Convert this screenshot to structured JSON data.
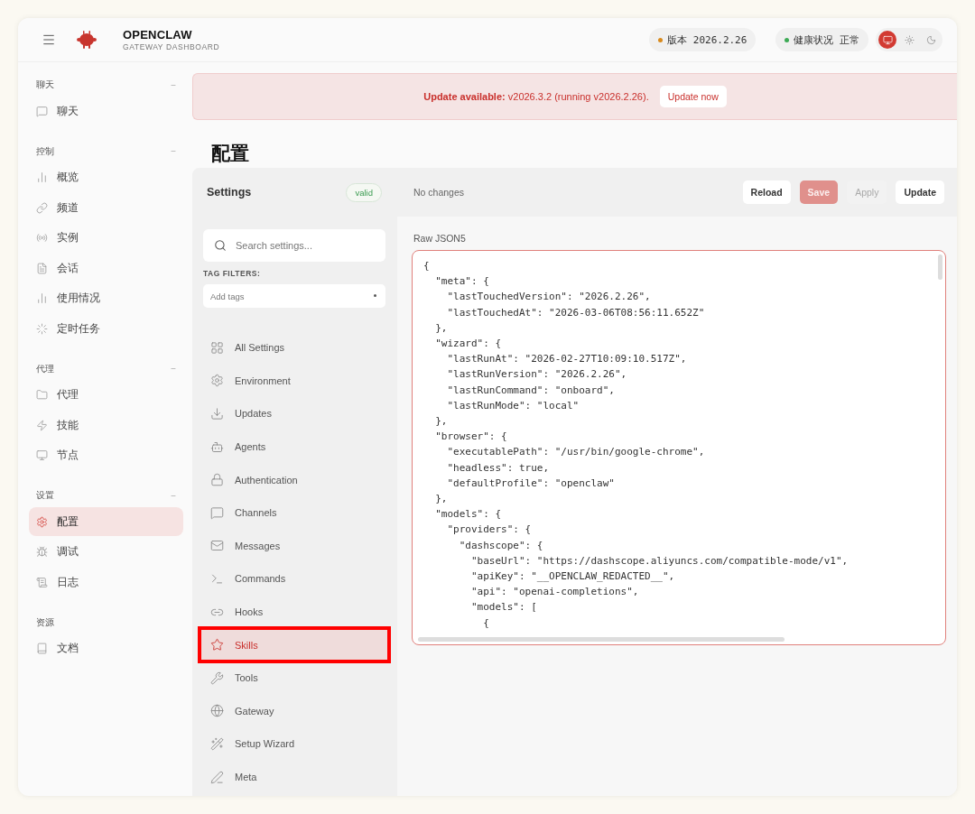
{
  "header": {
    "brand": "OPENCLAW",
    "subtitle": "GATEWAY DASHBOARD",
    "pills": [
      {
        "label": "版本",
        "value": "2026.2.26",
        "color": "#d98a1c"
      },
      {
        "label": "健康状况",
        "value": "正常",
        "color": "#3daa55"
      }
    ],
    "theme_modes": [
      {
        "selected": true
      },
      {
        "selected": false
      },
      {
        "selected": false
      }
    ]
  },
  "sidebar": {
    "groups": [
      {
        "title": "聊天",
        "toggle": "−",
        "items": [
          {
            "label": "聊天",
            "selected": false
          }
        ]
      },
      {
        "title": "控制",
        "toggle": "−",
        "items": [
          {
            "label": "概览",
            "selected": false
          },
          {
            "label": "频道",
            "selected": false
          },
          {
            "label": "实例",
            "selected": false
          },
          {
            "label": "会话",
            "selected": false
          },
          {
            "label": "使用情况",
            "selected": false
          },
          {
            "label": "定时任务",
            "selected": false
          }
        ]
      },
      {
        "title": "代理",
        "toggle": "−",
        "items": [
          {
            "label": "代理",
            "selected": false
          },
          {
            "label": "技能",
            "selected": false
          },
          {
            "label": "节点",
            "selected": false
          }
        ]
      },
      {
        "title": "设置",
        "toggle": "−",
        "items": [
          {
            "label": "配置",
            "selected": true
          },
          {
            "label": "调试",
            "selected": false
          },
          {
            "label": "日志",
            "selected": false
          }
        ]
      },
      {
        "title": "资源",
        "items": [
          {
            "label": "文档",
            "selected": false
          }
        ]
      }
    ]
  },
  "banner": {
    "lead": "**Update available:** v2026.3.2 (running v2026.2.26).",
    "button": "Update now"
  },
  "page": {
    "title": "配置"
  },
  "settings": {
    "title": "Settings",
    "badge": "valid",
    "search": {
      "placeholder": "Search settings..."
    },
    "tag_filters_label": "TAG FILTERS:",
    "tags": {
      "placeholder": "Add tags"
    },
    "nav": [
      {
        "label": "All Settings",
        "selected": false,
        "annotated": false
      },
      {
        "label": "Environment",
        "selected": false,
        "annotated": false
      },
      {
        "label": "Updates",
        "selected": false,
        "annotated": false
      },
      {
        "label": "Agents",
        "selected": false,
        "annotated": false
      },
      {
        "label": "Authentication",
        "selected": false,
        "annotated": false
      },
      {
        "label": "Channels",
        "selected": false,
        "annotated": false
      },
      {
        "label": "Messages",
        "selected": false,
        "annotated": false
      },
      {
        "label": "Commands",
        "selected": false,
        "annotated": false
      },
      {
        "label": "Hooks",
        "selected": false,
        "annotated": false
      },
      {
        "label": "Skills",
        "selected": true,
        "annotated": true
      },
      {
        "label": "Tools",
        "selected": false,
        "annotated": false
      },
      {
        "label": "Gateway",
        "selected": false,
        "annotated": false
      },
      {
        "label": "Setup Wizard",
        "selected": false,
        "annotated": false
      },
      {
        "label": "Meta",
        "selected": false,
        "annotated": false
      }
    ]
  },
  "toolbar": {
    "status": "No changes",
    "buttons": [
      {
        "label": "Reload",
        "kind": "default",
        "disabled": false
      },
      {
        "label": "Save",
        "kind": "primary",
        "disabled": true
      },
      {
        "label": "Apply",
        "kind": "default",
        "disabled": true
      },
      {
        "label": "Update",
        "kind": "default",
        "disabled": false
      }
    ]
  },
  "editor": {
    "label": "Raw JSON5",
    "lines": [
      "{",
      "  \"meta\": {",
      "    \"lastTouchedVersion\": \"2026.2.26\",",
      "    \"lastTouchedAt\": \"2026-03-06T08:56:11.652Z\"",
      "  },",
      "  \"wizard\": {",
      "    \"lastRunAt\": \"2026-02-27T10:09:10.517Z\",",
      "    \"lastRunVersion\": \"2026.2.26\",",
      "    \"lastRunCommand\": \"onboard\",",
      "    \"lastRunMode\": \"local\"",
      "  },",
      "  \"browser\": {",
      "    \"executablePath\": \"/usr/bin/google-chrome\",",
      "    \"headless\": true,",
      "    \"defaultProfile\": \"openclaw\"",
      "  },",
      "  \"models\": {",
      "    \"providers\": {",
      "      \"dashscope\": {",
      "        \"baseUrl\": \"https://dashscope.aliyuncs.com/compatible-mode/v1\",",
      "        \"apiKey\": \"__OPENCLAW_REDACTED__\",",
      "        \"api\": \"openai-completions\",",
      "        \"models\": [",
      "          {"
    ]
  }
}
